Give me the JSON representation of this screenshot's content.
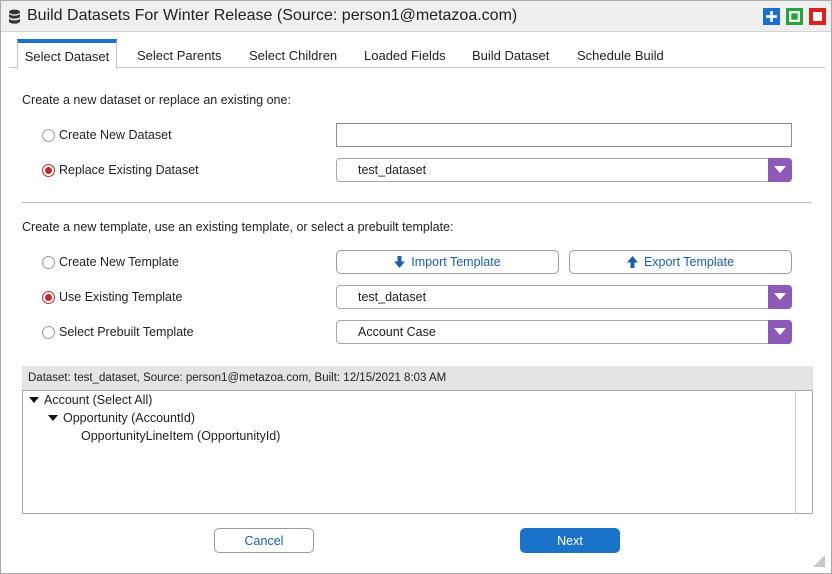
{
  "window": {
    "title": "Build Datasets For Winter Release (Source: person1@metazoa.com)",
    "icons": [
      "database-icon",
      "maximize-icon",
      "restore-icon",
      "close-icon"
    ]
  },
  "tabs": [
    {
      "label": "Select Dataset",
      "active": true
    },
    {
      "label": "Select Parents"
    },
    {
      "label": "Select Children"
    },
    {
      "label": "Loaded Fields"
    },
    {
      "label": "Build Dataset"
    },
    {
      "label": "Schedule Build"
    }
  ],
  "dataset_section": {
    "heading": "Create a new dataset or replace an existing one:",
    "create_new_label": "Create New Dataset",
    "create_new_value": "",
    "replace_label": "Replace Existing Dataset",
    "replace_value": "test_dataset",
    "selected": "replace"
  },
  "template_section": {
    "heading": "Create a new template, use an existing template, or select a prebuilt template:",
    "create_new_label": "Create New Template",
    "import_label": "Import Template",
    "export_label": "Export Template",
    "use_existing_label": "Use Existing Template",
    "use_existing_value": "test_dataset",
    "prebuilt_label": "Select Prebuilt Template",
    "prebuilt_value": "Account Case",
    "selected": "use_existing"
  },
  "info_bar": "Dataset: test_dataset, Source: person1@metazoa.com, Built: 12/15/2021 8:03 AM",
  "tree": [
    {
      "label": "Account (Select All)",
      "level": 0,
      "expanded": true
    },
    {
      "label": "Opportunity (AccountId)",
      "level": 1,
      "expanded": true
    },
    {
      "label": "OpportunityLineItem (OpportunityId)",
      "level": 2,
      "leaf": true
    }
  ],
  "footer": {
    "cancel_label": "Cancel",
    "next_label": "Next"
  },
  "colors": {
    "accent_blue": "#1b73c9",
    "radio_red": "#c62828",
    "dropdown_purple": "#8e5ab8",
    "close_red": "#d8231c",
    "restore_green": "#27a33b"
  }
}
